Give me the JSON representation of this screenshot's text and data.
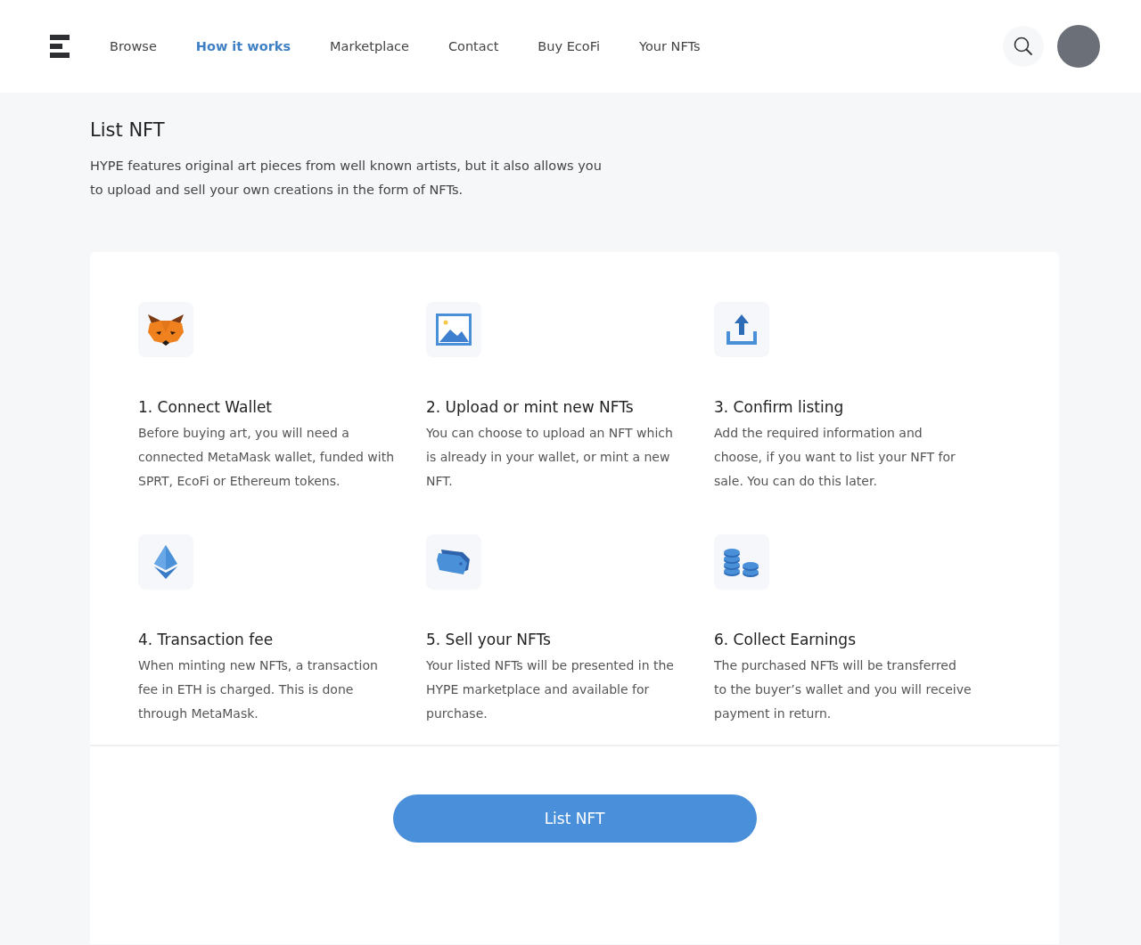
{
  "nav": [
    {
      "label": "Browse",
      "selected": false
    },
    {
      "label": "How it works",
      "selected": true
    },
    {
      "label": "Marketplace",
      "selected": false
    },
    {
      "label": "Contact",
      "selected": false
    },
    {
      "label": "Buy EcoFi",
      "selected": false
    },
    {
      "label": "Your NFTs",
      "selected": false
    }
  ],
  "page": {
    "title": "List NFT",
    "description": "HYPE features original art pieces from well known artists, but it also allows you to upload and sell your own creations in the form of NFTs."
  },
  "steps": [
    {
      "kind": "fox",
      "title": "1. Connect Wallet",
      "text": "Before buying art, you will need a connected MetaMask wallet, funded with SPRT, EcoFi or Ethereum tokens."
    },
    {
      "kind": "image",
      "title": "2. Upload or mint new NFTs",
      "text": "You can choose to upload an NFT which is already in your wallet, or mint a new NFT."
    },
    {
      "kind": "upload",
      "title": "3. Confirm listing",
      "text": "Add the required information and choose, if you want to list your NFT for sale. You can do this later."
    },
    {
      "kind": "ethereum",
      "title": "4. Transaction fee",
      "text": "When minting new NFTs, a transaction fee in ETH is charged. This is done through MetaMask."
    },
    {
      "kind": "tag",
      "title": "5. Sell your NFTs",
      "text": "Your listed NFTs will be presented in the HYPE marketplace and available for purchase."
    },
    {
      "kind": "coins",
      "title": "6. Collect Earnings",
      "text": "The purchased NFTs will be transferred to the buyer’s wallet and you will receive payment in return."
    }
  ],
  "button": "List NFT"
}
